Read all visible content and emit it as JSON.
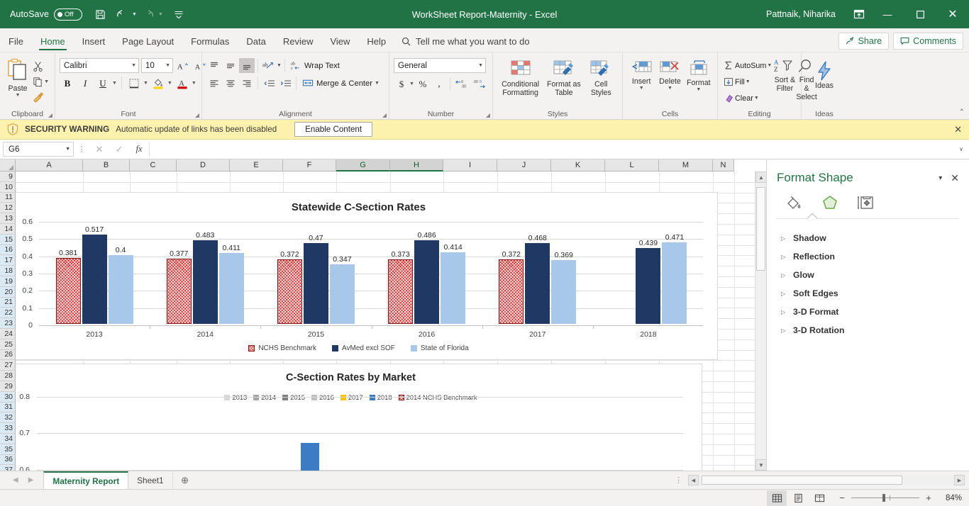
{
  "titlebar": {
    "autosave_label": "AutoSave",
    "autosave_state": "Off",
    "document_title": "WorkSheet Report-Maternity  -  Excel",
    "user_name": "Pattnaik, Niharika",
    "save_icon": "save-icon",
    "undo_icon": "undo-icon",
    "redo_icon": "redo-icon",
    "qat_more_icon": "customize-quick-access-toolbar-icon",
    "ribbon_display_icon": "ribbon-display-options-icon",
    "minimize": "—",
    "maximize": "☐",
    "close": "✕"
  },
  "ribbon_tabs": [
    {
      "label": "File",
      "active": false
    },
    {
      "label": "Home",
      "active": true
    },
    {
      "label": "Insert",
      "active": false
    },
    {
      "label": "Page Layout",
      "active": false
    },
    {
      "label": "Formulas",
      "active": false
    },
    {
      "label": "Data",
      "active": false
    },
    {
      "label": "Review",
      "active": false
    },
    {
      "label": "View",
      "active": false
    },
    {
      "label": "Help",
      "active": false
    }
  ],
  "tellme": {
    "placeholder": "Tell me what you want to do"
  },
  "share": {
    "label": "Share"
  },
  "comments": {
    "label": "Comments"
  },
  "ribbon": {
    "clipboard": {
      "group_name": "Clipboard",
      "paste_label": "Paste",
      "cut_label": "Cut",
      "copy_label": "Copy",
      "format_painter_label": "Format Painter"
    },
    "font": {
      "group_name": "Font",
      "font_family": "Calibri",
      "font_size": "10",
      "grow_font": "A",
      "shrink_font": "A",
      "bold": "B",
      "italic": "I",
      "underline": "U"
    },
    "alignment": {
      "group_name": "Alignment",
      "wrap_text": "Wrap Text",
      "merge_center": "Merge & Center"
    },
    "number": {
      "group_name": "Number",
      "format": "General",
      "accounting": "$",
      "percent": "%",
      "comma": "'"
    },
    "styles": {
      "group_name": "Styles",
      "conditional_formatting_l1": "Conditional",
      "conditional_formatting_l2": "Formatting",
      "format_as_table_l1": "Format as",
      "format_as_table_l2": "Table",
      "cell_styles_l1": "Cell",
      "cell_styles_l2": "Styles"
    },
    "cells": {
      "group_name": "Cells",
      "insert": "Insert",
      "delete": "Delete",
      "format": "Format"
    },
    "editing": {
      "group_name": "Editing",
      "autosum": "AutoSum",
      "fill": "Fill",
      "clear": "Clear",
      "sort_filter_l1": "Sort &",
      "sort_filter_l2": "Filter",
      "find_select_l1": "Find &",
      "find_select_l2": "Select"
    },
    "ideas": {
      "group_name": "Ideas",
      "ideas": "Ideas"
    }
  },
  "security_bar": {
    "title": "SECURITY WARNING",
    "message": "Automatic update of links has been disabled",
    "button": "Enable Content",
    "close": "✕"
  },
  "formula_bar": {
    "name_box": "G6",
    "cancel": "✕",
    "enter": "✓",
    "fx": "fx",
    "value": "",
    "expand": "∨"
  },
  "grid": {
    "columns": [
      "A",
      "B",
      "C",
      "D",
      "E",
      "F",
      "G",
      "H",
      "I",
      "J",
      "K",
      "L",
      "M",
      "N"
    ],
    "selected_columns": [
      "G",
      "H"
    ],
    "rows": [
      9,
      10,
      11,
      12,
      13,
      14,
      15,
      16,
      17,
      18,
      19,
      20,
      21,
      22,
      23,
      24,
      25,
      26,
      27,
      28,
      29,
      30,
      31,
      32,
      33,
      34,
      35,
      36,
      37
    ],
    "highlighted_rows": [
      15,
      16,
      17,
      18,
      19,
      20,
      21,
      22,
      23,
      30,
      31,
      32,
      33,
      34,
      35,
      36,
      37
    ]
  },
  "chart_data": [
    {
      "type": "bar",
      "title": "Statewide C-Section Rates",
      "xlabel": "",
      "ylabel": "",
      "ylim": [
        0,
        0.6
      ],
      "yticks": [
        "0",
        "0.1",
        "0.2",
        "0.3",
        "0.4",
        "0.5",
        "0.6"
      ],
      "grid": true,
      "legend_position": "bottom",
      "categories": [
        "2013",
        "2014",
        "2015",
        "2016",
        "2017",
        "2018"
      ],
      "series": [
        {
          "name": "NCHS Benchmark",
          "color": "#e02020",
          "values": [
            0.381,
            0.377,
            0.372,
            0.373,
            0.372,
            null
          ]
        },
        {
          "name": "AvMed excl SOF",
          "color": "#1f3864",
          "values": [
            0.517,
            0.483,
            0.47,
            0.486,
            0.468,
            0.439
          ]
        },
        {
          "name": "State of Florida",
          "color": "#a7c8e8",
          "values": [
            0.4,
            0.411,
            0.347,
            0.414,
            0.369,
            0.471
          ]
        }
      ]
    },
    {
      "type": "bar",
      "title": "C-Section Rates by Market",
      "xlabel": "",
      "ylabel": "",
      "ylim": [
        0.5,
        0.8
      ],
      "yticks": [
        "0.6",
        "0.7",
        "0.8"
      ],
      "grid": true,
      "legend_position": "top",
      "categories": [
        ""
      ],
      "series": [
        {
          "name": "2013",
          "color": "#d9d9d9",
          "values": [
            null
          ]
        },
        {
          "name": "2014",
          "color": "#a6a6a6",
          "values": [
            null
          ]
        },
        {
          "name": "2015",
          "color": "#7f7f7f",
          "values": [
            null
          ]
        },
        {
          "name": "2016",
          "color": "#bfbfbf",
          "values": [
            null
          ]
        },
        {
          "name": "2017",
          "color": "#ffc000",
          "values": [
            null
          ]
        },
        {
          "name": "2018",
          "color": "#3b7cc4",
          "values": [
            0.67
          ]
        },
        {
          "name": "2014 NCHS Benchmark",
          "color": "#e02020",
          "values": [
            null
          ]
        }
      ]
    }
  ],
  "format_pane": {
    "title": "Format Shape",
    "caret": "▾",
    "close": "✕",
    "tabs": [
      {
        "name": "fill-line-tab",
        "icon": "paint-bucket-icon",
        "active": false
      },
      {
        "name": "effects-tab",
        "icon": "pentagon-icon",
        "active": true
      },
      {
        "name": "size-properties-tab",
        "icon": "size-properties-icon",
        "active": false
      }
    ],
    "sections": [
      {
        "label": "Shadow"
      },
      {
        "label": "Reflection"
      },
      {
        "label": "Glow"
      },
      {
        "label": "Soft Edges"
      },
      {
        "label": "3-D Format"
      },
      {
        "label": "3-D Rotation"
      }
    ]
  },
  "sheet_tabs": {
    "prev": "◀",
    "next": "▶",
    "tabs": [
      {
        "label": "Maternity Report",
        "active": true
      },
      {
        "label": "Sheet1",
        "active": false
      }
    ],
    "add": "⊕"
  },
  "status_bar": {
    "normal_view": "normal-view-icon",
    "page_layout_view": "page-layout-view-icon",
    "page_break_view": "page-break-preview-icon",
    "zoom_out": "−",
    "zoom_in": "+",
    "zoom_level": "84%"
  }
}
